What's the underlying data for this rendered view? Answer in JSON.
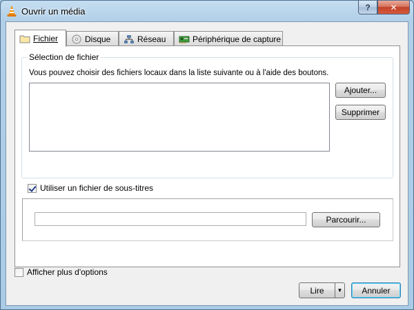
{
  "window": {
    "title": "Ouvrir un média",
    "help_label": "?",
    "close_label": "✕"
  },
  "tabs": [
    {
      "label": "Fichier",
      "icon": "folder-icon",
      "active": true
    },
    {
      "label": "Disque",
      "icon": "disc-icon",
      "active": false
    },
    {
      "label": "Réseau",
      "icon": "network-icon",
      "active": false
    },
    {
      "label": "Périphérique de capture",
      "icon": "capture-card-icon",
      "active": false
    }
  ],
  "file_selection": {
    "group_title": "Sélection de fichier",
    "description": "Vous pouvez choisir des fichiers locaux dans la liste suivante ou à l'aide des boutons.",
    "add_label": "Ajouter...",
    "remove_label": "Supprimer"
  },
  "subtitles": {
    "checkbox_label": "Utiliser un fichier de sous-titres",
    "checked": true,
    "path_value": "",
    "browse_label": "Parcourir..."
  },
  "footer": {
    "more_options_label": "Afficher plus d'options",
    "more_options_checked": false,
    "play_label": "Lire",
    "cancel_label": "Annuler"
  },
  "colors": {
    "title_bar": "#b0cfe8",
    "close_button": "#c2442a",
    "dialog_background": "#f0f0f0"
  }
}
